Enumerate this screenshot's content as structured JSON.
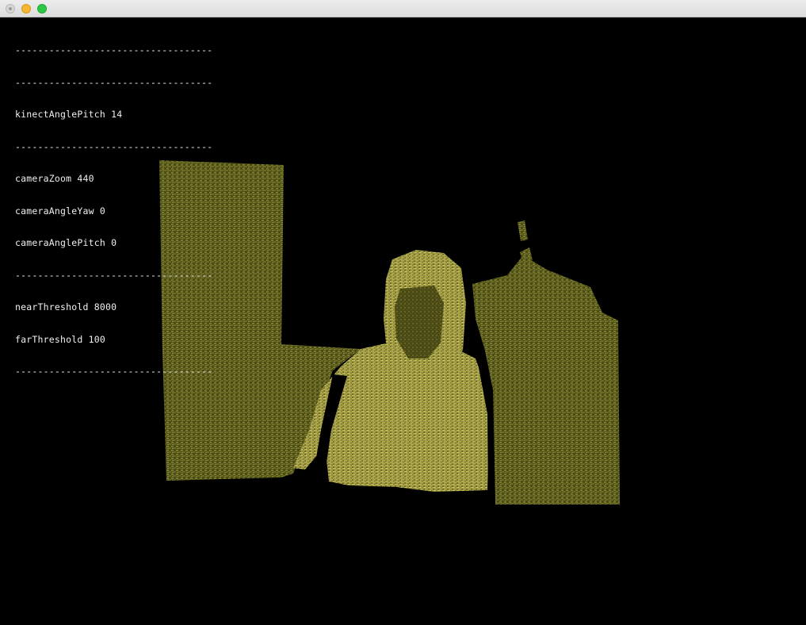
{
  "window": {
    "title": ""
  },
  "hud": {
    "separator": "-----------------------------------",
    "kinect_angle_pitch": "kinectAnglePitch 14",
    "camera_zoom": "cameraZoom 440",
    "camera_angle_yaw": "cameraAngleYaw 0",
    "camera_angle_pitch": "cameraAnglePitch 0",
    "near_threshold": "nearThreshold 8000",
    "far_threshold": "farThreshold 100"
  },
  "colors": {
    "background": "#000000",
    "point_dark": "#5a5a1e",
    "point_mid": "#7d7d32",
    "point_light": "#c8c25a",
    "hud_text": "#f0f0f0"
  }
}
